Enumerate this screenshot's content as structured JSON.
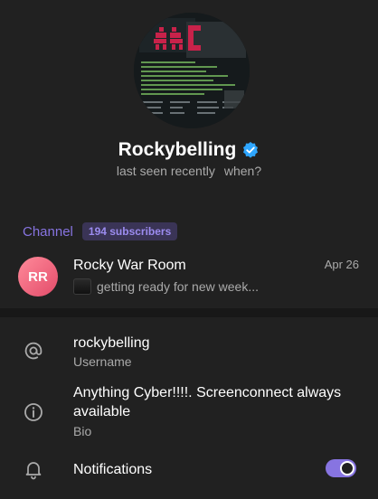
{
  "profile": {
    "name": "Rockybelling",
    "status": "last seen recently",
    "when_label": "when?"
  },
  "channel": {
    "section_label": "Channel",
    "subscribers": "194 subscribers",
    "avatar_initials": "RR",
    "title": "Rocky War Room",
    "date": "Apr 26",
    "preview": "getting ready for new week..."
  },
  "info": {
    "username_value": "rockybelling",
    "username_label": "Username",
    "bio_line1": "Anything Cyber!!!!. Screenconnect always",
    "bio_line2": "available",
    "bio_label": "Bio",
    "notifications_label": "Notifications",
    "notifications_on": true
  },
  "colors": {
    "accent": "#8774e1",
    "background": "#212121",
    "verified": "#2ea6ff",
    "channel_avatar": "#e34c6a"
  },
  "icons": [
    "verified-badge-icon",
    "at-sign-icon",
    "info-icon",
    "bell-icon"
  ]
}
